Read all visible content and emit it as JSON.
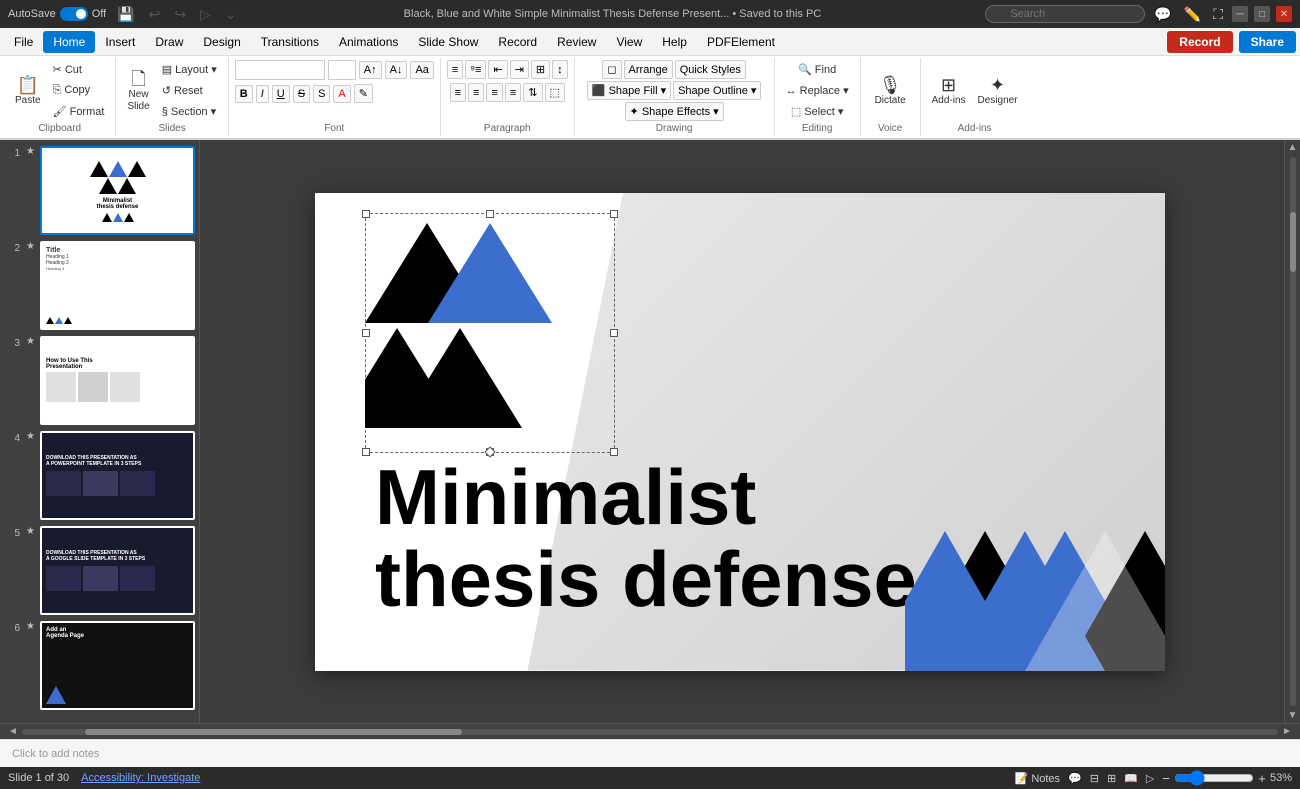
{
  "titleBar": {
    "autosave": "AutoSave",
    "autosaveState": "Off",
    "title": "Black, Blue and White Simple Minimalist Thesis Defense Present... • Saved to this PC",
    "searchPlaceholder": "Search",
    "windowControls": [
      "minimize",
      "maximize",
      "close"
    ]
  },
  "menuBar": {
    "items": [
      "File",
      "Home",
      "Insert",
      "Draw",
      "Design",
      "Transitions",
      "Animations",
      "Slide Show",
      "Record",
      "Review",
      "View",
      "Help",
      "PDFElement"
    ],
    "activeItem": "Home",
    "recordButton": "Record",
    "shareButton": "Share"
  },
  "ribbon": {
    "groups": [
      {
        "name": "Clipboard",
        "buttons": [
          "Paste",
          "Cut",
          "Copy",
          "Format Painter"
        ]
      },
      {
        "name": "Slides",
        "buttons": [
          "New Slide",
          "Layout",
          "Reset",
          "Section"
        ]
      },
      {
        "name": "Font",
        "fontName": "",
        "fontSize": "",
        "buttons": [
          "Bold",
          "Italic",
          "Underline",
          "Strikethrough",
          "Shadow",
          "Clear Formatting",
          "Font Color",
          "Highlight"
        ]
      },
      {
        "name": "Paragraph",
        "buttons": [
          "Bullets",
          "Numbering",
          "Decrease Indent",
          "Increase Indent",
          "Align Left",
          "Center",
          "Align Right",
          "Justify"
        ]
      },
      {
        "name": "Drawing",
        "buttons": [
          "Shapes",
          "Arrange",
          "Quick Styles",
          "Shape Fill",
          "Shape Outline",
          "Shape Effects"
        ]
      },
      {
        "name": "Editing",
        "buttons": [
          "Find",
          "Replace",
          "Select"
        ]
      },
      {
        "name": "Voice",
        "buttons": [
          "Dictate"
        ]
      },
      {
        "name": "Add-ins",
        "buttons": [
          "Add-ins",
          "Designer"
        ]
      }
    ]
  },
  "slides": [
    {
      "num": "1",
      "starred": true,
      "selected": true,
      "title": "Minimalist thesis defense"
    },
    {
      "num": "2",
      "starred": true,
      "selected": false,
      "title": "Title slide layout"
    },
    {
      "num": "3",
      "starred": true,
      "selected": false,
      "title": "How to Use This Presentation"
    },
    {
      "num": "4",
      "starred": true,
      "selected": false,
      "title": "Download PowerPoint"
    },
    {
      "num": "5",
      "starred": true,
      "selected": false,
      "title": "Download Google Slides"
    },
    {
      "num": "6",
      "starred": true,
      "selected": false,
      "title": "Add an Agenda Page"
    }
  ],
  "mainSlide": {
    "title1": "Minimalist",
    "title2": "thesis defense"
  },
  "notesArea": {
    "placeholder": "Click to add notes"
  },
  "statusBar": {
    "slideInfo": "Slide 1 of 30",
    "accessibility": "Accessibility: Investigate",
    "notes": "Notes",
    "zoom": "53%"
  },
  "colors": {
    "blue": "#3c6fcd",
    "black": "#000000",
    "white": "#ffffff",
    "recordRed": "#c42b1c",
    "microsoftBlue": "#0078d4"
  }
}
